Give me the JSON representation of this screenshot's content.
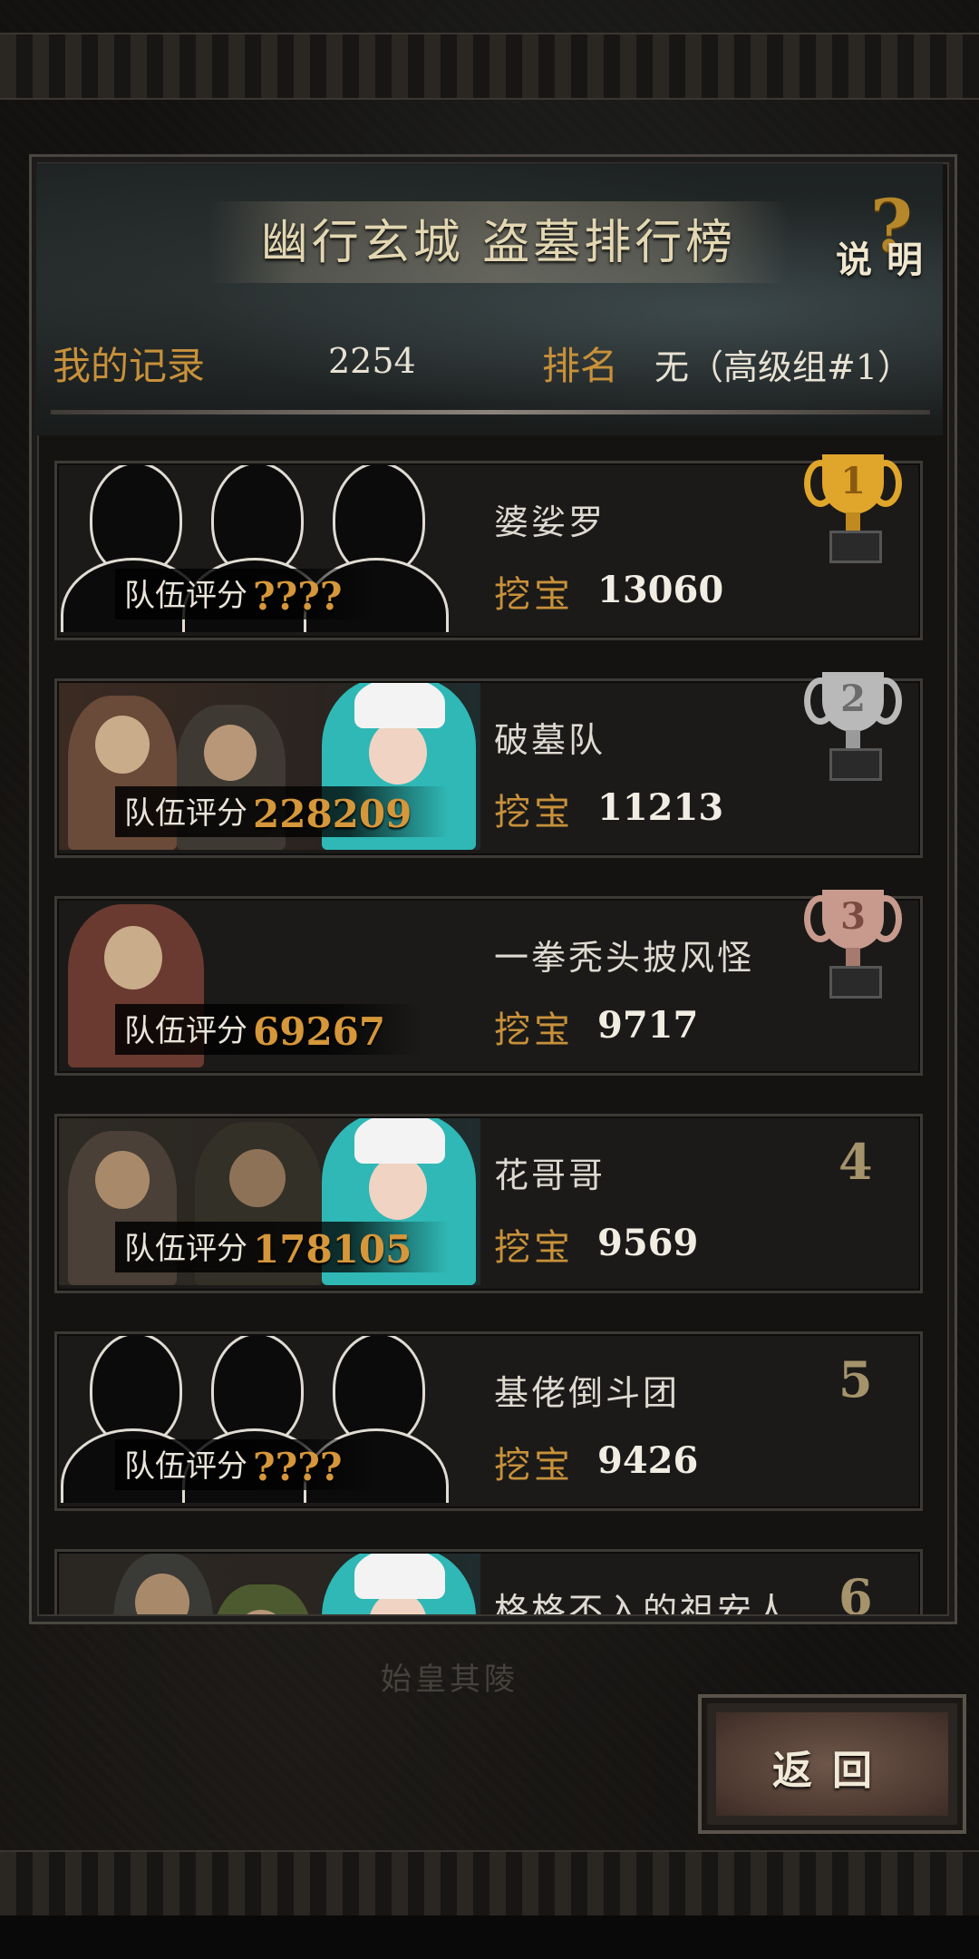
{
  "header": {
    "title": "幽行玄城 盗墓排行榜",
    "help_label": "说明",
    "help_glyph": "?"
  },
  "my_record": {
    "label": "我的记录",
    "value": "2254",
    "rank_label": "排名",
    "rank_value": "无（高级组#1）"
  },
  "score_label": "队伍评分",
  "dig_label": "挖宝",
  "entries": [
    {
      "rank": "1",
      "name": "婆娑罗",
      "team_score": "????",
      "dig": "13060",
      "portrait": "silhouettes",
      "trophy": "gold"
    },
    {
      "rank": "2",
      "name": "破墓队",
      "team_score": "228209",
      "dig": "11213",
      "portrait": "characters",
      "trophy": "silver"
    },
    {
      "rank": "3",
      "name": "一拳秃头披风怪",
      "team_score": "69267",
      "dig": "9717",
      "portrait": "character-single",
      "trophy": "bronze"
    },
    {
      "rank": "4",
      "name": "花哥哥",
      "team_score": "178105",
      "dig": "9569",
      "portrait": "characters"
    },
    {
      "rank": "5",
      "name": "基佬倒斗团",
      "team_score": "????",
      "dig": "9426",
      "portrait": "silhouettes"
    },
    {
      "rank": "6",
      "name": "格格不入的祖安人",
      "portrait": "characters"
    }
  ],
  "background_caption": "始皇其陵",
  "back_button": {
    "label": "返回"
  },
  "colors": {
    "gold_text": "#c8913a",
    "score_value": "#d6973a",
    "trophy_gold": "#e0a52b",
    "trophy_silver": "#b9b9b9",
    "trophy_bronze": "#c79a8d"
  }
}
